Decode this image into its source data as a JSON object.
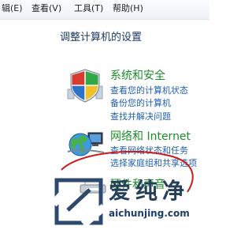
{
  "menubar": {
    "items": [
      {
        "label": "辑(E)"
      },
      {
        "label": "查看(V)"
      },
      {
        "label": "工具(T)"
      },
      {
        "label": "帮助(H)"
      }
    ]
  },
  "page_title": "调整计算机的设置",
  "categories": [
    {
      "title": "系统和安全",
      "icon": "shield-icon",
      "links": [
        "查看您的计算机状态",
        "备份您的计算机",
        "查找并解决问题"
      ]
    },
    {
      "title": "网络和 Internet",
      "icon": "network-globe-icon",
      "links": [
        "查看网络状态和任务",
        "选择家庭组和共享选项"
      ]
    },
    {
      "title": "硬件和声音",
      "icon": "printer-icon",
      "links": []
    }
  ],
  "annotation": {
    "color": "#cc1a1a"
  },
  "watermark": {
    "text": "爱纯净",
    "url": "aichunjing.com",
    "color": "#1e3d6d"
  }
}
